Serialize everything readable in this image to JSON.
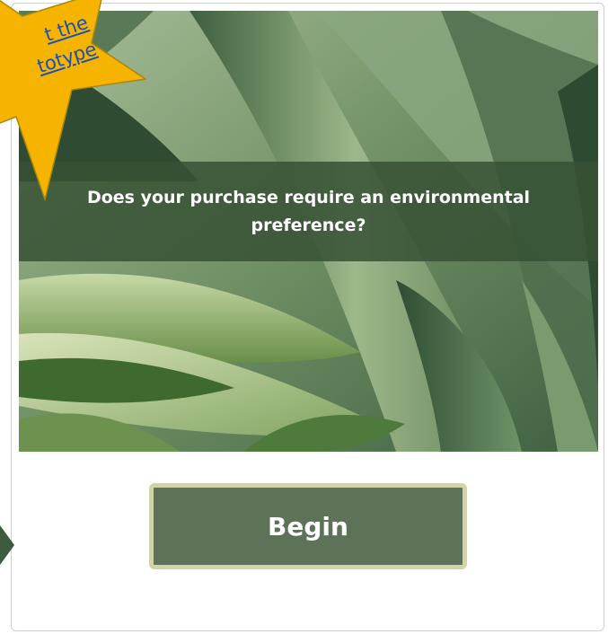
{
  "hero": {
    "question": "Does your purchase require an environmental preference?",
    "background_icon": "agave-plant-image"
  },
  "actions": {
    "begin_label": "Begin"
  },
  "badge": {
    "link_text_line1": "t the",
    "link_text_line2": "totype",
    "color": "#f6b400",
    "link_color": "#1a4fb4"
  },
  "colors": {
    "banner": "#375234",
    "button_fill": "#5d7259",
    "button_border": "#d2d3a7",
    "card_border": "#cfcfcf"
  },
  "left_nav_icon": "triangle-arrow-left-icon"
}
